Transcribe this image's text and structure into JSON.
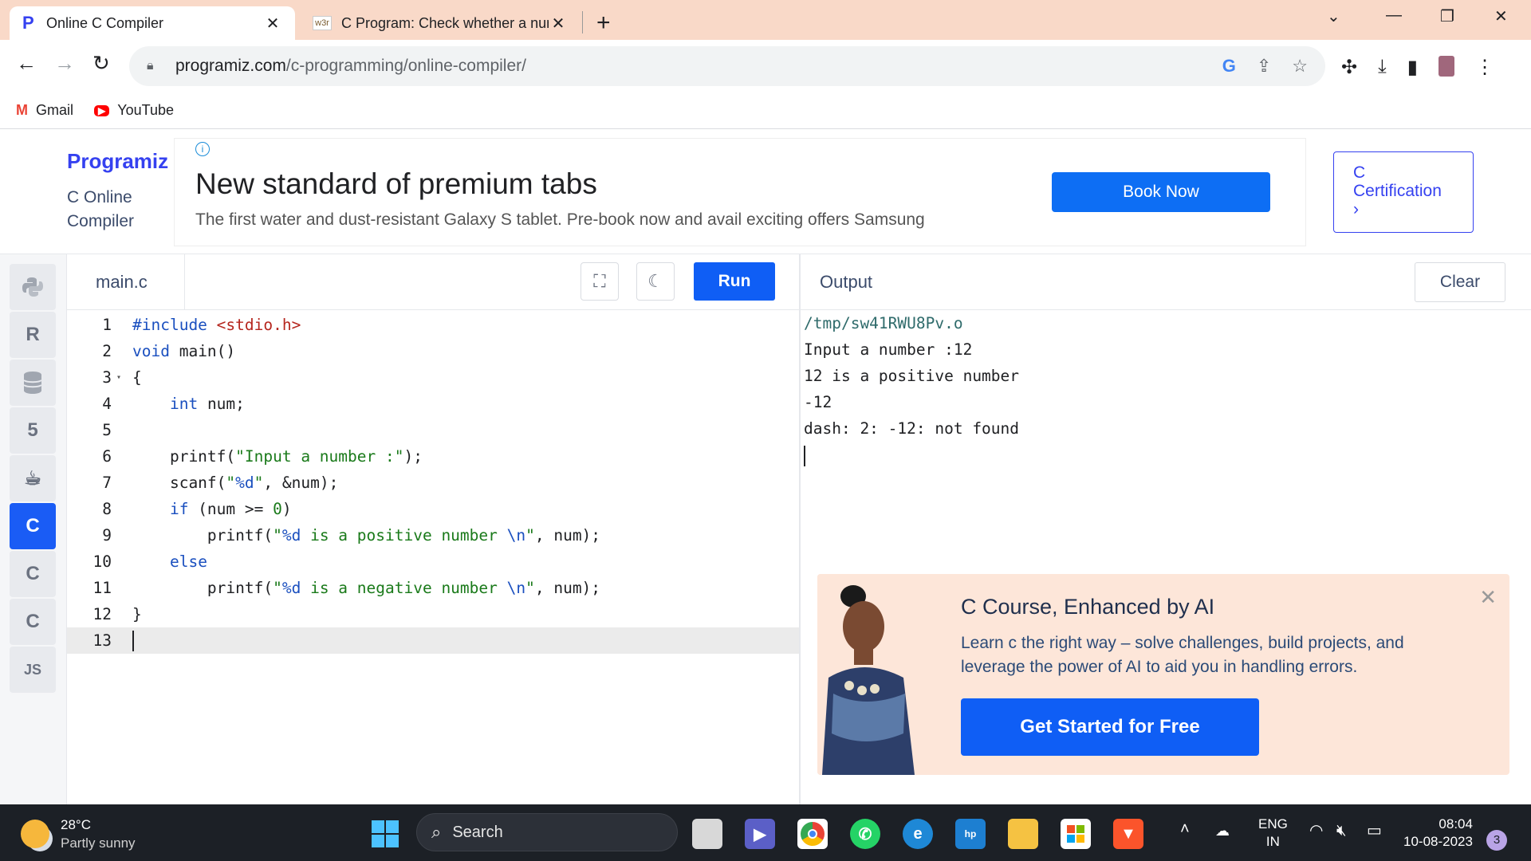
{
  "browser": {
    "tabs": [
      {
        "title": "Online C Compiler",
        "active": true
      },
      {
        "title": "C Program: Check whether a num",
        "active": false,
        "favicon_text": "w3r"
      }
    ],
    "url_host": "programiz.com",
    "url_path": "/c-programming/online-compiler/",
    "bookmarks": [
      {
        "label": "Gmail",
        "icon": "gmail-icon"
      },
      {
        "label": "YouTube",
        "icon": "youtube-icon"
      }
    ]
  },
  "site": {
    "logo": "Programiz",
    "subtitle_line1": "C Online",
    "subtitle_line2": "Compiler",
    "ad": {
      "headline": "New standard of premium tabs",
      "description": "The first water and dust-resistant Galaxy S tablet. Pre-book now and avail exciting offers Samsung",
      "button": "Book Now"
    },
    "cert_line1": "C",
    "cert_line2": "Certification",
    "cert_arrow": "›"
  },
  "languages": [
    {
      "name": "python-icon",
      "label": ""
    },
    {
      "name": "r-icon",
      "label": "R"
    },
    {
      "name": "sql-icon",
      "label": ""
    },
    {
      "name": "html5-icon",
      "label": "5"
    },
    {
      "name": "java-icon",
      "label": ""
    },
    {
      "name": "c-icon",
      "label": "C",
      "active": true
    },
    {
      "name": "cpp-icon",
      "label": "C"
    },
    {
      "name": "csharp-icon",
      "label": "C"
    },
    {
      "name": "js-icon",
      "label": "JS"
    }
  ],
  "editor": {
    "filename": "main.c",
    "run_label": "Run",
    "lines": [
      {
        "n": "1",
        "code": "#include <stdio.h>"
      },
      {
        "n": "2",
        "code": "void main()"
      },
      {
        "n": "3",
        "code": "{",
        "fold": "▾"
      },
      {
        "n": "4",
        "code": "    int num;"
      },
      {
        "n": "5",
        "code": ""
      },
      {
        "n": "6",
        "code": "    printf(\"Input a number :\");"
      },
      {
        "n": "7",
        "code": "    scanf(\"%d\", &num);"
      },
      {
        "n": "8",
        "code": "    if (num >= 0)"
      },
      {
        "n": "9",
        "code": "        printf(\"%d is a positive number \\n\", num);"
      },
      {
        "n": "10",
        "code": "    else"
      },
      {
        "n": "11",
        "code": "        printf(\"%d is a negative number \\n\", num);"
      },
      {
        "n": "12",
        "code": "}"
      },
      {
        "n": "13",
        "code": ""
      }
    ]
  },
  "output": {
    "title": "Output",
    "clear_label": "Clear",
    "path": "/tmp/sw41RWU8Pv.o",
    "lines": [
      "Input a number :12",
      "12 is a positive number",
      "-12",
      "dash: 2: -12: not found"
    ]
  },
  "course_ad": {
    "title": "C Course, Enhanced by AI",
    "description": "Learn c the right way – solve challenges, build projects, and leverage the power of AI to aid you in handling errors.",
    "cta": "Get Started for Free"
  },
  "taskbar": {
    "temperature": "28°C",
    "weather": "Partly sunny",
    "search_placeholder": "Search",
    "lang_line1": "ENG",
    "lang_line2": "IN",
    "time": "08:04",
    "date": "10-08-2023",
    "notification_count": "3"
  }
}
